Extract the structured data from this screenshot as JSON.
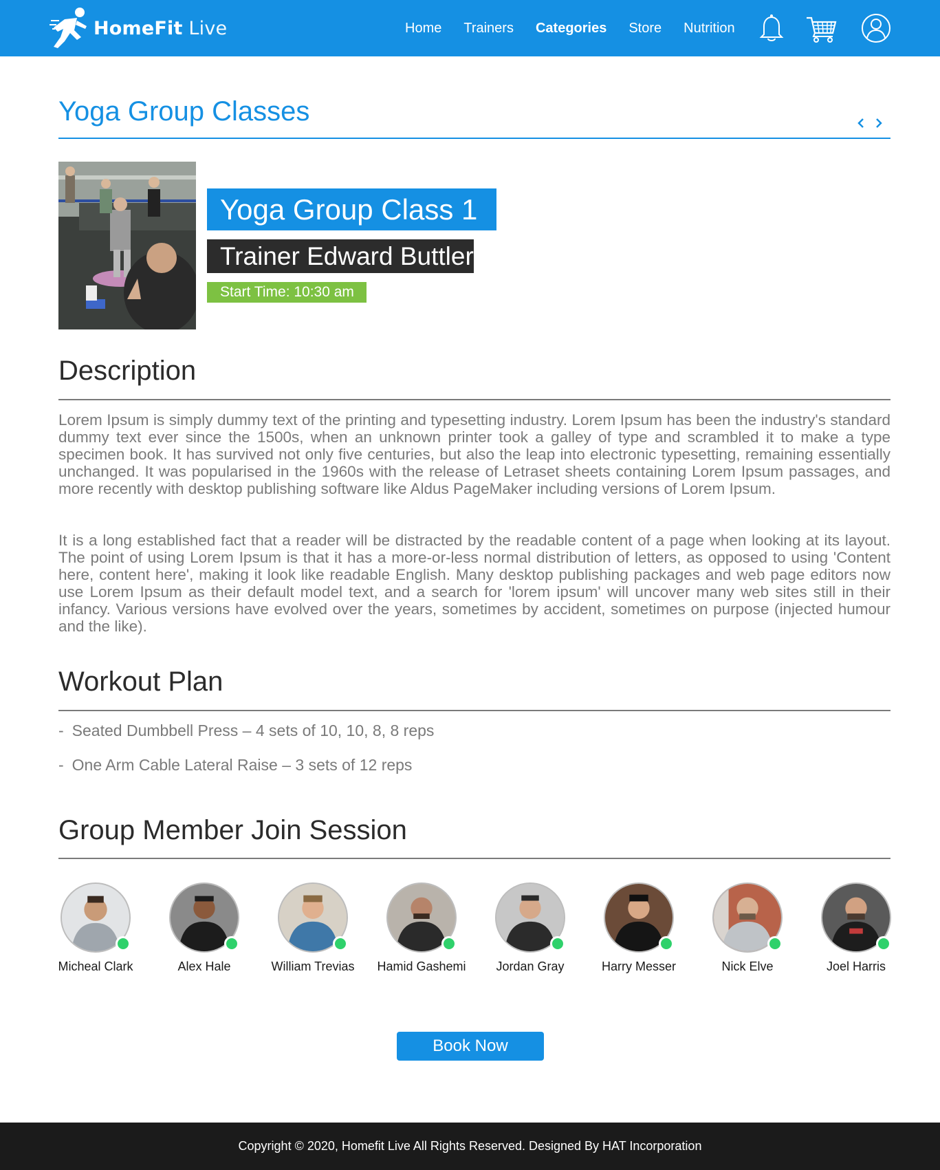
{
  "brand": {
    "name_bold": "HomeFit",
    "name_light": "Live"
  },
  "nav": {
    "items": [
      {
        "label": "Home",
        "active": false
      },
      {
        "label": "Trainers",
        "active": false
      },
      {
        "label": "Categories",
        "active": true
      },
      {
        "label": "Store",
        "active": false
      },
      {
        "label": "Nutrition",
        "active": false
      }
    ],
    "icons": [
      "bell-icon",
      "cart-icon",
      "user-icon"
    ]
  },
  "page": {
    "title": "Yoga Group Classes"
  },
  "class_card": {
    "name": "Yoga Group Class 1",
    "trainer": "Trainer Edward Buttler",
    "start_time": "Start Time: 10:30 am"
  },
  "description": {
    "heading": "Description",
    "paragraphs": [
      "Lorem Ipsum is simply dummy text of the printing and typesetting industry. Lorem Ipsum has been the industry's standard dummy text ever since the 1500s, when an unknown printer took a galley of type and scrambled it to make a type specimen book. It has survived not only five centuries, but also the leap into electronic typesetting, remaining essentially unchanged. It was popularised in the 1960s with the release of Letraset sheets containing Lorem Ipsum passages, and more recently with desktop publishing software like Aldus PageMaker including versions of Lorem Ipsum.",
      "It is a long established fact that a reader will be distracted by the readable content of a page when looking at its layout. The point of using Lorem Ipsum is that it has a more-or-less normal distribution of letters, as opposed to using 'Content here, content here', making it look like readable English. Many desktop publishing packages and web page editors now use Lorem Ipsum as their default model text, and a search for 'lorem ipsum' will uncover many web sites still in their infancy. Various versions have evolved over the years, sometimes by accident, sometimes on purpose (injected humour and the like)."
    ]
  },
  "workout_plan": {
    "heading": "Workout Plan",
    "items": [
      {
        "dash": "-",
        "text": "Seated Dumbbell Press – 4 sets of 10, 10, 8, 8 reps"
      },
      {
        "dash": "-",
        "text": "One Arm Cable Lateral Raise – 3 sets of 12 reps"
      }
    ]
  },
  "members": {
    "heading": "Group Member Join Session",
    "list": [
      {
        "name": "Micheal Clark",
        "online": true
      },
      {
        "name": "Alex Hale",
        "online": true
      },
      {
        "name": "William Trevias",
        "online": true
      },
      {
        "name": "Hamid Gashemi",
        "online": true
      },
      {
        "name": "Jordan Gray",
        "online": true
      },
      {
        "name": "Harry Messer",
        "online": true
      },
      {
        "name": "Nick Elve",
        "online": true
      },
      {
        "name": "Joel Harris",
        "online": true
      }
    ]
  },
  "book_button": "Book Now",
  "footer": {
    "text": "Copyright © 2020, Homefit Live All Rights Reserved. Designed By HAT Incorporation"
  },
  "colors": {
    "brand_blue": "#1590e3",
    "trainer_bg": "#2c2c2c",
    "time_green": "#7dc142",
    "online_green": "#2fd16b",
    "footer_bg": "#1b1b1b"
  }
}
